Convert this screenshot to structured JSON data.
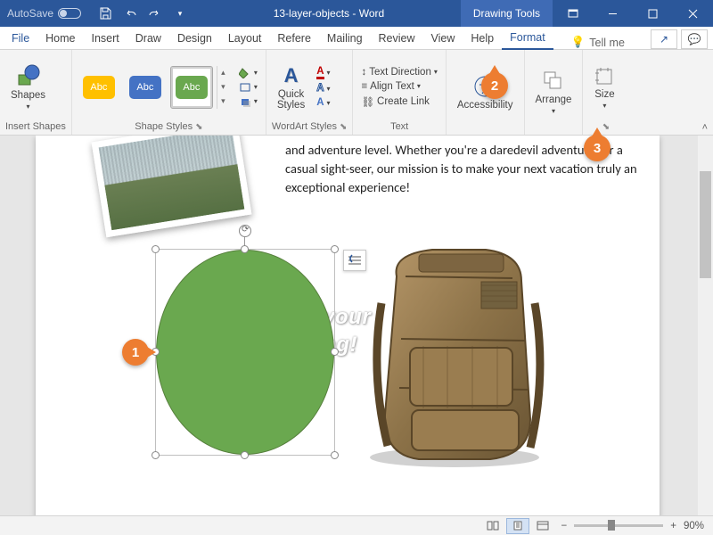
{
  "titlebar": {
    "autosave": "AutoSave",
    "doc_title": "13-layer-objects - Word",
    "drawing_tools": "Drawing Tools"
  },
  "tabs": {
    "file": "File",
    "home": "Home",
    "insert": "Insert",
    "draw": "Draw",
    "design": "Design",
    "layout": "Layout",
    "references": "Refere",
    "mailings": "Mailing",
    "review": "Review",
    "view": "View",
    "help": "Help",
    "format": "Format",
    "tellme": "Tell me"
  },
  "ribbon": {
    "shapes": "Shapes",
    "insert_shapes": "Insert Shapes",
    "shape_styles": "Shape Styles",
    "abc": "Abc",
    "quick_styles": "Quick\nStyles",
    "wordart_styles": "WordArt Styles",
    "text_direction": "Text Direction",
    "align_text": "Align Text",
    "create_link": "Create Link",
    "text_group": "Text",
    "accessibility": "Accessibility",
    "arrange": "Arrange",
    "size": "Size"
  },
  "document": {
    "paragraph": "and adventure level. Whether you're a daredevil adventurer or a casual sight-seer, our mission is to make your next vacation truly an exceptional experience!",
    "wordart_line1": "ab your",
    "wordart_line2": "o bag!"
  },
  "callouts": {
    "c1": "1",
    "c2": "2",
    "c3": "3"
  },
  "status": {
    "zoom": "90%"
  },
  "colors": {
    "sample1": "#ffc000",
    "sample2": "#4472c4",
    "sample3": "#6aa84f"
  }
}
